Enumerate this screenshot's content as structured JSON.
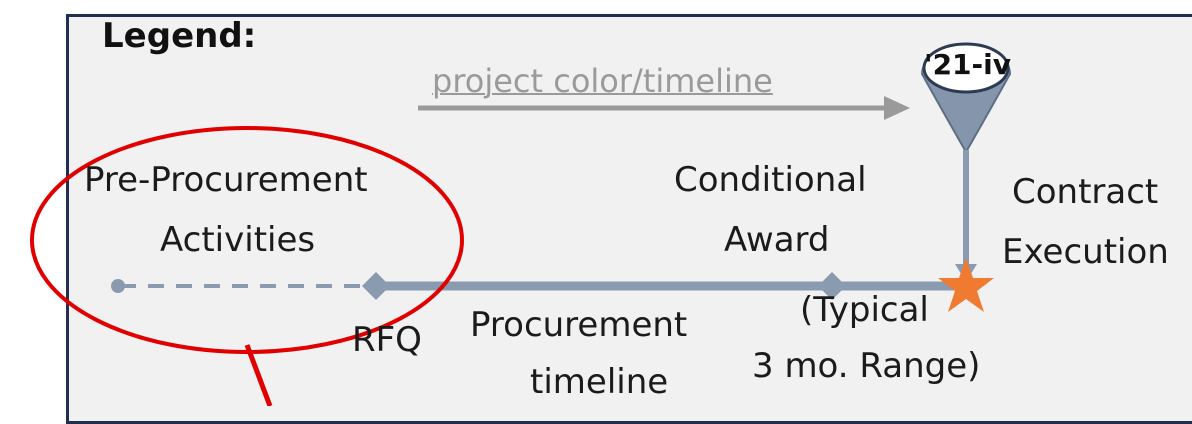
{
  "legend": {
    "title": "Legend:",
    "timeline_label": "project color/timeline",
    "pin_label": "'21-iv"
  },
  "milestones": {
    "pre_procurement_line1": "Pre-Procurement",
    "pre_procurement_line2": "Activities",
    "conditional_line1": "Conditional",
    "conditional_line2": "Award",
    "contract_line1": "Contract",
    "contract_line2": "Execution",
    "rfq": "RFQ",
    "procurement_line1": "Procurement",
    "procurement_line2": "timeline",
    "typical_line1": "(Typical",
    "typical_line2": "3 mo. Range)"
  },
  "colors": {
    "frame_border": "#1f2f4d",
    "timeline": "#8a9aaf",
    "legend_arrow": "#9a9a9a",
    "star": "#f07a30",
    "highlight": "#e00000"
  }
}
